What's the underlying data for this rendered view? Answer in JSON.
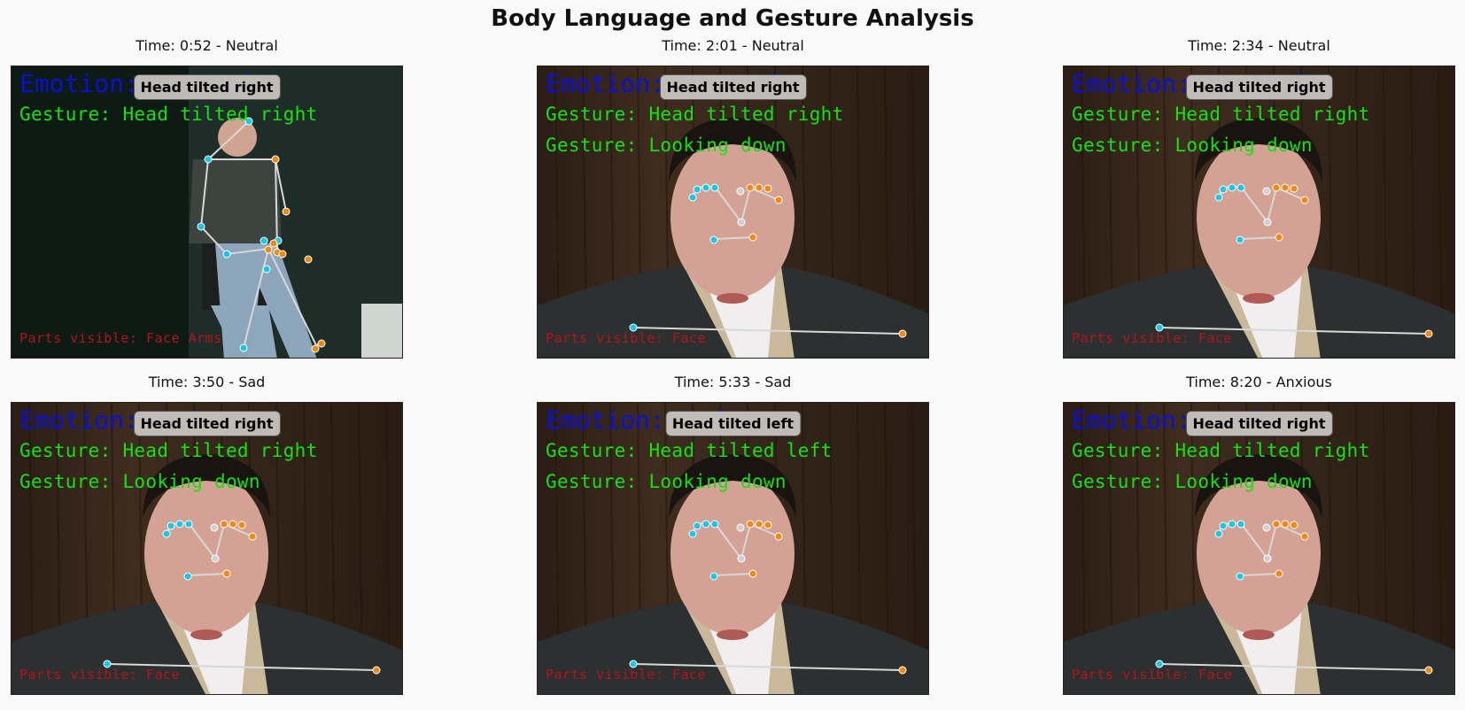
{
  "title": "Body Language and Gesture Analysis",
  "panels": [
    {
      "title": "Time: 0:52 - Neutral",
      "badge": "Head tilted right",
      "emotion": "Emotion: Neutral",
      "gestures": [
        "Gesture: Head tilted right"
      ],
      "parts": "Parts visible: Face Arms",
      "scene": "full-body"
    },
    {
      "title": "Time: 2:01 - Neutral",
      "badge": "Head tilted right",
      "emotion": "Emotion: Neutral",
      "gestures": [
        "Gesture: Head tilted right",
        "Gesture: Looking down"
      ],
      "parts": "Parts visible: Face",
      "scene": "closeup"
    },
    {
      "title": "Time: 2:34 - Neutral",
      "badge": "Head tilted right",
      "emotion": "Emotion: Neutral",
      "gestures": [
        "Gesture: Head tilted right",
        "Gesture: Looking down"
      ],
      "parts": "Parts visible: Face",
      "scene": "closeup"
    },
    {
      "title": "Time: 3:50 - Sad",
      "badge": "Head tilted right",
      "emotion": "Emotion: Sad",
      "gestures": [
        "Gesture: Head tilted right",
        "Gesture: Looking down"
      ],
      "parts": "Parts visible: Face",
      "scene": "closeup"
    },
    {
      "title": "Time: 5:33 - Sad",
      "badge": "Head tilted left",
      "emotion": "Emotion: Sad",
      "gestures": [
        "Gesture: Head tilted left",
        "Gesture: Looking down"
      ],
      "parts": "Parts visible: Face",
      "scene": "closeup"
    },
    {
      "title": "Time: 8:20 - Anxious",
      "badge": "Head tilted right",
      "emotion": "Emotion: Anxious",
      "gestures": [
        "Gesture: Head tilted right",
        "Gesture: Looking down"
      ],
      "parts": "Parts visible: Face",
      "scene": "closeup"
    }
  ],
  "colors": {
    "emotion_text": "#0a10d8",
    "gesture_text": "#15e20f",
    "parts_text": "#b4141a",
    "keypoint_left": "#18c8e6",
    "keypoint_right": "#f08a10",
    "skeleton": "#d8d8d8"
  }
}
